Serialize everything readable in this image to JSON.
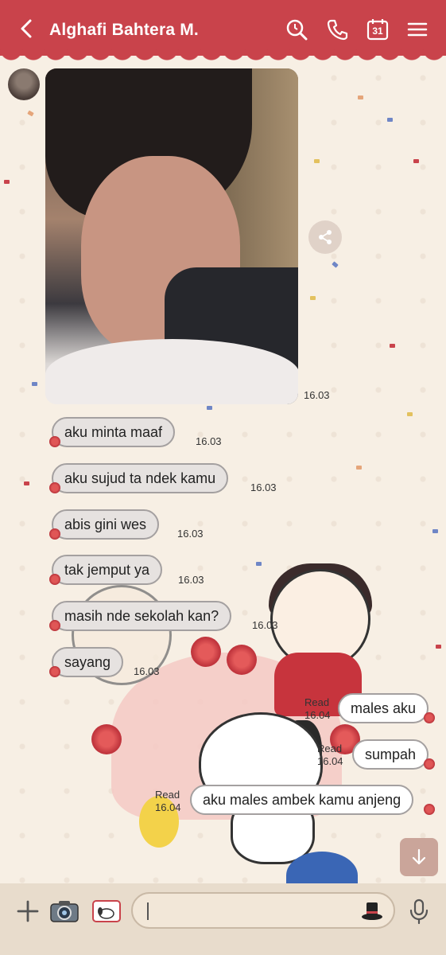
{
  "header": {
    "title": "Alghafi Bahtera M.",
    "calendar_day": "31",
    "accent_color": "#c9434b"
  },
  "messages_in": [
    {
      "text": "aku minta maaf",
      "time": "16.03"
    },
    {
      "text": "aku sujud ta ndek kamu",
      "time": "16.03"
    },
    {
      "text": "abis gini wes",
      "time": "16.03"
    },
    {
      "text": "tak jemput ya",
      "time": "16.03"
    },
    {
      "text": "masih nde sekolah kan?",
      "time": "16.03"
    },
    {
      "text": "sayang",
      "time": "16.03"
    }
  ],
  "photo_time": "16.03",
  "messages_out": [
    {
      "text": "males aku",
      "read": "Read",
      "time": "16.04"
    },
    {
      "text": "sumpah",
      "read": "Read",
      "time": "16.04"
    },
    {
      "text": "aku males ambek kamu anjeng",
      "read": "Read",
      "time": "16.04"
    }
  ],
  "icons": {
    "back": "chevron-left-icon",
    "search": "search-icon",
    "call": "phone-icon",
    "calendar": "calendar-icon",
    "menu": "menu-icon",
    "share": "share-icon",
    "scroll": "arrow-down-icon",
    "plus": "plus-icon",
    "camera": "camera-icon",
    "gallery": "image-icon",
    "sticker": "hat-sticker-icon",
    "mic": "mic-icon"
  }
}
